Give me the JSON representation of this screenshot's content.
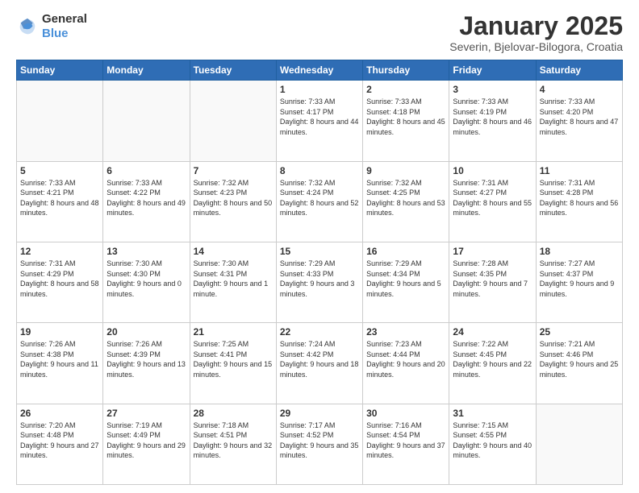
{
  "header": {
    "logo_line1": "General",
    "logo_line2": "Blue",
    "month": "January 2025",
    "location": "Severin, Bjelovar-Bilogora, Croatia"
  },
  "days_of_week": [
    "Sunday",
    "Monday",
    "Tuesday",
    "Wednesday",
    "Thursday",
    "Friday",
    "Saturday"
  ],
  "weeks": [
    [
      {
        "day": "",
        "content": ""
      },
      {
        "day": "",
        "content": ""
      },
      {
        "day": "",
        "content": ""
      },
      {
        "day": "1",
        "content": "Sunrise: 7:33 AM\nSunset: 4:17 PM\nDaylight: 8 hours\nand 44 minutes."
      },
      {
        "day": "2",
        "content": "Sunrise: 7:33 AM\nSunset: 4:18 PM\nDaylight: 8 hours\nand 45 minutes."
      },
      {
        "day": "3",
        "content": "Sunrise: 7:33 AM\nSunset: 4:19 PM\nDaylight: 8 hours\nand 46 minutes."
      },
      {
        "day": "4",
        "content": "Sunrise: 7:33 AM\nSunset: 4:20 PM\nDaylight: 8 hours\nand 47 minutes."
      }
    ],
    [
      {
        "day": "5",
        "content": "Sunrise: 7:33 AM\nSunset: 4:21 PM\nDaylight: 8 hours\nand 48 minutes."
      },
      {
        "day": "6",
        "content": "Sunrise: 7:33 AM\nSunset: 4:22 PM\nDaylight: 8 hours\nand 49 minutes."
      },
      {
        "day": "7",
        "content": "Sunrise: 7:32 AM\nSunset: 4:23 PM\nDaylight: 8 hours\nand 50 minutes."
      },
      {
        "day": "8",
        "content": "Sunrise: 7:32 AM\nSunset: 4:24 PM\nDaylight: 8 hours\nand 52 minutes."
      },
      {
        "day": "9",
        "content": "Sunrise: 7:32 AM\nSunset: 4:25 PM\nDaylight: 8 hours\nand 53 minutes."
      },
      {
        "day": "10",
        "content": "Sunrise: 7:31 AM\nSunset: 4:27 PM\nDaylight: 8 hours\nand 55 minutes."
      },
      {
        "day": "11",
        "content": "Sunrise: 7:31 AM\nSunset: 4:28 PM\nDaylight: 8 hours\nand 56 minutes."
      }
    ],
    [
      {
        "day": "12",
        "content": "Sunrise: 7:31 AM\nSunset: 4:29 PM\nDaylight: 8 hours\nand 58 minutes."
      },
      {
        "day": "13",
        "content": "Sunrise: 7:30 AM\nSunset: 4:30 PM\nDaylight: 9 hours\nand 0 minutes."
      },
      {
        "day": "14",
        "content": "Sunrise: 7:30 AM\nSunset: 4:31 PM\nDaylight: 9 hours\nand 1 minute."
      },
      {
        "day": "15",
        "content": "Sunrise: 7:29 AM\nSunset: 4:33 PM\nDaylight: 9 hours\nand 3 minutes."
      },
      {
        "day": "16",
        "content": "Sunrise: 7:29 AM\nSunset: 4:34 PM\nDaylight: 9 hours\nand 5 minutes."
      },
      {
        "day": "17",
        "content": "Sunrise: 7:28 AM\nSunset: 4:35 PM\nDaylight: 9 hours\nand 7 minutes."
      },
      {
        "day": "18",
        "content": "Sunrise: 7:27 AM\nSunset: 4:37 PM\nDaylight: 9 hours\nand 9 minutes."
      }
    ],
    [
      {
        "day": "19",
        "content": "Sunrise: 7:26 AM\nSunset: 4:38 PM\nDaylight: 9 hours\nand 11 minutes."
      },
      {
        "day": "20",
        "content": "Sunrise: 7:26 AM\nSunset: 4:39 PM\nDaylight: 9 hours\nand 13 minutes."
      },
      {
        "day": "21",
        "content": "Sunrise: 7:25 AM\nSunset: 4:41 PM\nDaylight: 9 hours\nand 15 minutes."
      },
      {
        "day": "22",
        "content": "Sunrise: 7:24 AM\nSunset: 4:42 PM\nDaylight: 9 hours\nand 18 minutes."
      },
      {
        "day": "23",
        "content": "Sunrise: 7:23 AM\nSunset: 4:44 PM\nDaylight: 9 hours\nand 20 minutes."
      },
      {
        "day": "24",
        "content": "Sunrise: 7:22 AM\nSunset: 4:45 PM\nDaylight: 9 hours\nand 22 minutes."
      },
      {
        "day": "25",
        "content": "Sunrise: 7:21 AM\nSunset: 4:46 PM\nDaylight: 9 hours\nand 25 minutes."
      }
    ],
    [
      {
        "day": "26",
        "content": "Sunrise: 7:20 AM\nSunset: 4:48 PM\nDaylight: 9 hours\nand 27 minutes."
      },
      {
        "day": "27",
        "content": "Sunrise: 7:19 AM\nSunset: 4:49 PM\nDaylight: 9 hours\nand 29 minutes."
      },
      {
        "day": "28",
        "content": "Sunrise: 7:18 AM\nSunset: 4:51 PM\nDaylight: 9 hours\nand 32 minutes."
      },
      {
        "day": "29",
        "content": "Sunrise: 7:17 AM\nSunset: 4:52 PM\nDaylight: 9 hours\nand 35 minutes."
      },
      {
        "day": "30",
        "content": "Sunrise: 7:16 AM\nSunset: 4:54 PM\nDaylight: 9 hours\nand 37 minutes."
      },
      {
        "day": "31",
        "content": "Sunrise: 7:15 AM\nSunset: 4:55 PM\nDaylight: 9 hours\nand 40 minutes."
      },
      {
        "day": "",
        "content": ""
      }
    ]
  ]
}
